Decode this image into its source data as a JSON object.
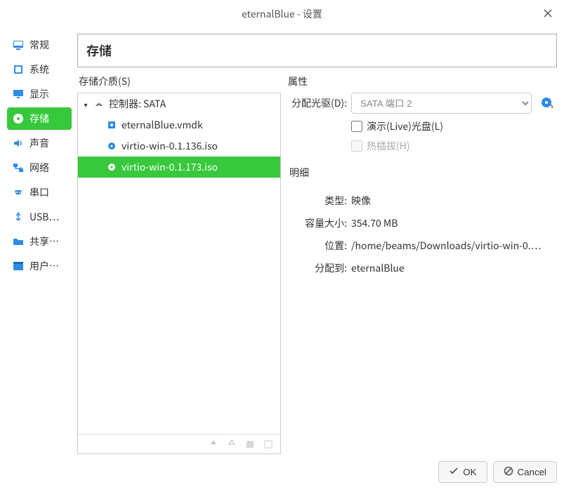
{
  "titlebar": {
    "title": "eternalBlue - 设置"
  },
  "sidebar": {
    "items": [
      {
        "label": "常规",
        "name": "sidebar-item-general",
        "icon": "monitor-icon",
        "color": "#2e8be6"
      },
      {
        "label": "系统",
        "name": "sidebar-item-system",
        "icon": "chip-icon",
        "color": "#2e8be6"
      },
      {
        "label": "显示",
        "name": "sidebar-item-display",
        "icon": "display-icon",
        "color": "#2e8be6"
      },
      {
        "label": "存储",
        "name": "sidebar-item-storage",
        "icon": "disk-icon",
        "color": "#ffffff",
        "selected": true
      },
      {
        "label": "声音",
        "name": "sidebar-item-audio",
        "icon": "speaker-icon",
        "color": "#2e8be6"
      },
      {
        "label": "网络",
        "name": "sidebar-item-network",
        "icon": "network-icon",
        "color": "#2e8be6"
      },
      {
        "label": "串口",
        "name": "sidebar-item-serial",
        "icon": "plug-icon",
        "color": "#2e8be6"
      },
      {
        "label": "USB…",
        "name": "sidebar-item-usb",
        "icon": "usb-icon",
        "color": "#2e8be6"
      },
      {
        "label": "共享…",
        "name": "sidebar-item-shared",
        "icon": "folder-icon",
        "color": "#2e8be6"
      },
      {
        "label": "用户…",
        "name": "sidebar-item-user",
        "icon": "window-icon",
        "color": "#2e8be6"
      }
    ]
  },
  "page": {
    "title": "存储"
  },
  "storage": {
    "section_title": "存储介质(S)",
    "controller": {
      "label": "控制器: SATA"
    },
    "devices": [
      {
        "label": "eternalBlue.vmdk",
        "type": "hdd",
        "name": "tree-device-vmdk"
      },
      {
        "label": "virtio-win-0.1.136.iso",
        "type": "disc",
        "name": "tree-device-disc-1"
      },
      {
        "label": "virtio-win-0.1.173.iso",
        "type": "disc",
        "name": "tree-device-disc-2",
        "selected": true
      }
    ]
  },
  "attributes": {
    "section_title": "属性",
    "drive_label": "分配光驱(D):",
    "drive_value": "SATA 端口 2",
    "live_label": "演示(Live)光盘(L)",
    "hotplug_label": "热插拔(H)"
  },
  "details": {
    "section_title": "明细",
    "rows": [
      {
        "label": "类型:",
        "value": "映像"
      },
      {
        "label": "容量大小:",
        "value": "354.70 MB"
      },
      {
        "label": "位置:",
        "value": "/home/beams/Downloads/virtio-win-0.…"
      },
      {
        "label": "分配到:",
        "value": "eternalBlue"
      }
    ]
  },
  "footer": {
    "ok": "OK",
    "cancel": "Cancel"
  }
}
